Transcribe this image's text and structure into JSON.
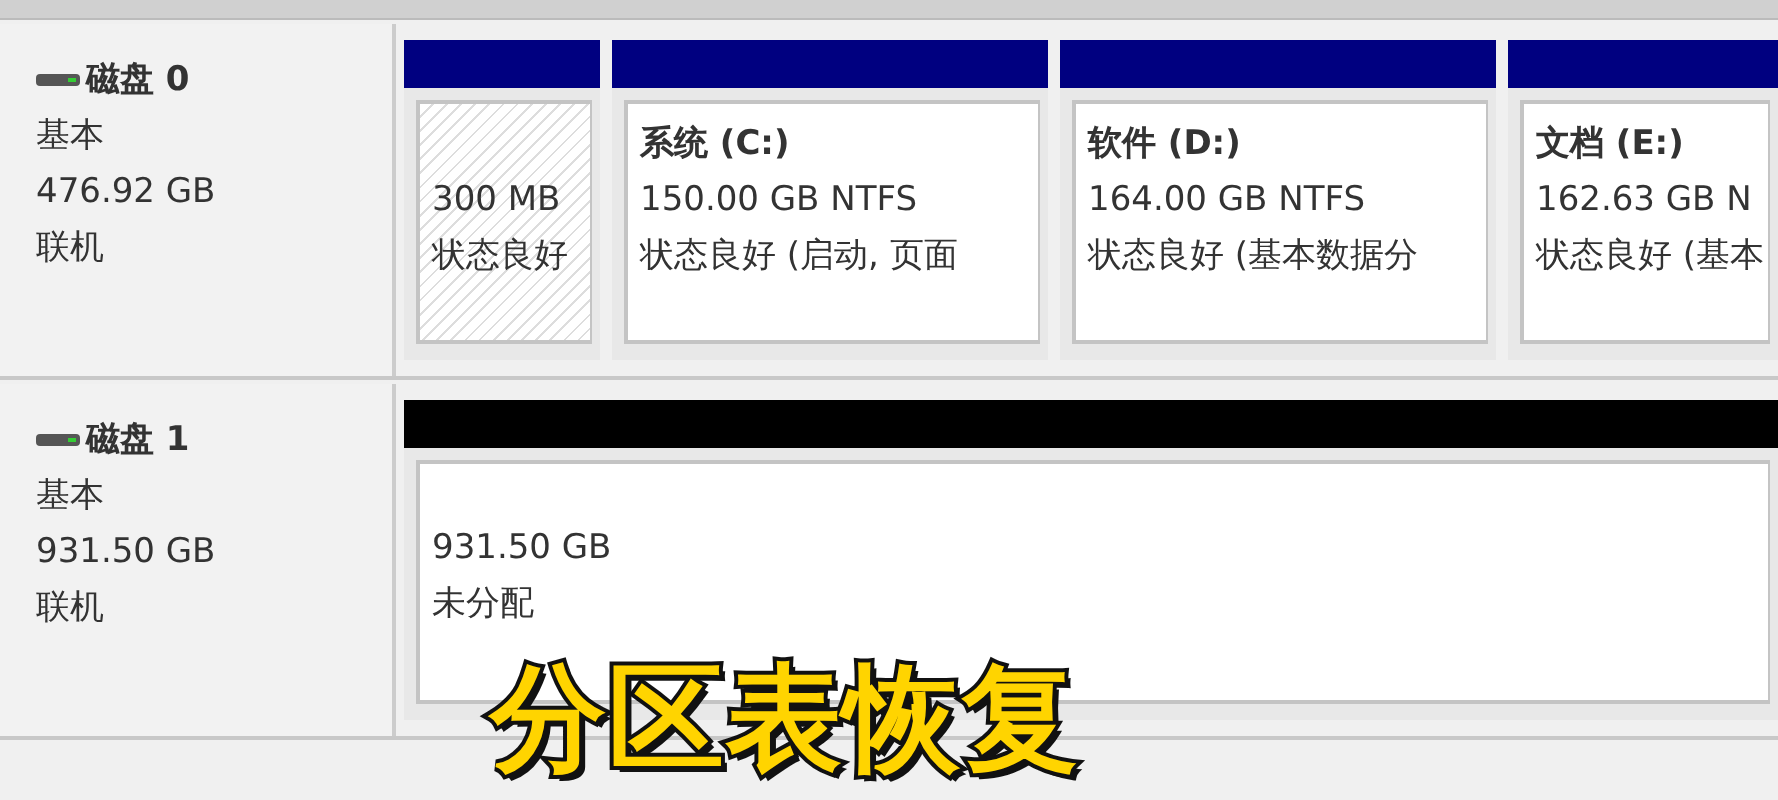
{
  "disks": [
    {
      "name": "磁盘 0",
      "type": "基本",
      "size": "476.92 GB",
      "status": "联机",
      "partitions": [
        {
          "kind": "reserved",
          "size": "300 MB",
          "status": "状态良好"
        },
        {
          "kind": "primary",
          "title": "系统 (C:)",
          "size": "150.00 GB NTFS",
          "status": "状态良好 (启动, 页面"
        },
        {
          "kind": "primary",
          "title": "软件 (D:)",
          "size": "164.00 GB NTFS",
          "status": "状态良好 (基本数据分"
        },
        {
          "kind": "primary",
          "title": "文档 (E:)",
          "size": "162.63 GB N",
          "status": "状态良好 (基本"
        }
      ]
    },
    {
      "name": "磁盘 1",
      "type": "基本",
      "size": "931.50 GB",
      "status": "联机",
      "partitions": [
        {
          "kind": "unallocated",
          "size": "931.50 GB",
          "status": "未分配"
        }
      ]
    }
  ],
  "caption": "分区表恢复"
}
